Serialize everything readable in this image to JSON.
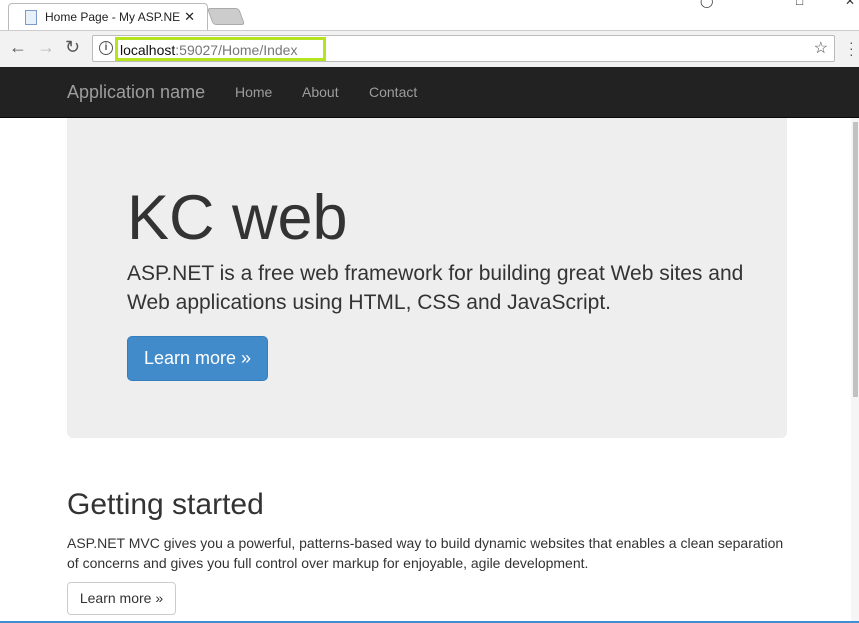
{
  "browser": {
    "tab_title": "Home Page - My ASP.NE",
    "url_host": "localhost",
    "url_rest": ":59027/Home/Index"
  },
  "navbar": {
    "brand": "Application name",
    "items": [
      {
        "label": "Home"
      },
      {
        "label": "About"
      },
      {
        "label": "Contact"
      }
    ]
  },
  "jumbotron": {
    "title": "KC web",
    "lead": "ASP.NET is a free web framework for building great Web sites and Web applications using HTML, CSS and JavaScript.",
    "button": "Learn more »"
  },
  "getting_started": {
    "title": "Getting started",
    "text": "ASP.NET MVC gives you a powerful, patterns-based way to build dynamic websites that enables a clean separation of concerns and gives you full control over markup for enjoyable, agile development.",
    "button": "Learn more »"
  },
  "colors": {
    "highlight": "#b5e31f",
    "primary": "#428bca",
    "navbar": "#222222"
  }
}
